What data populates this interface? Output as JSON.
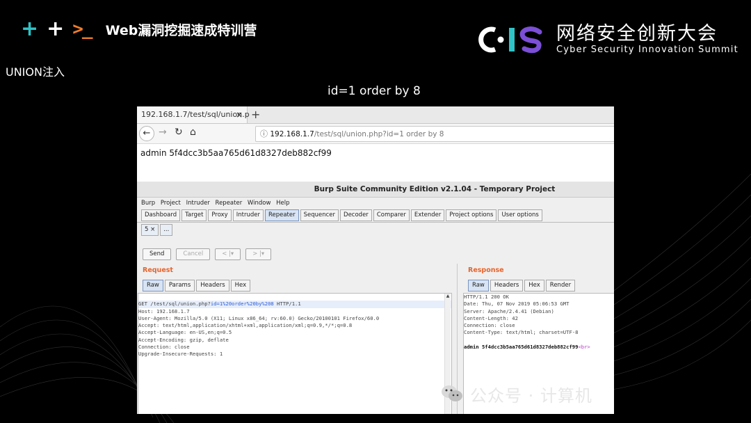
{
  "header": {
    "icons": [
      "plus-teal-icon",
      "plus-white-icon",
      "terminal-prompt-icon"
    ],
    "prompt_glyph": ">_",
    "course_title": "Web漏洞挖掘速成特训营"
  },
  "logo": {
    "cn": "网络安全创新大会",
    "en": "Cyber Security Innovation Summit",
    "colors": {
      "c": "#ffffff",
      "i": "#2fc3c7",
      "s": "#7b4fd6"
    }
  },
  "slide": {
    "subtitle": "UNION注入",
    "caption": "id=1 order by 8"
  },
  "browser": {
    "tab_title": "192.168.1.7/test/sql/union.p",
    "tab_close": "×",
    "new_tab": "+",
    "url_host": "192.168.1.7",
    "url_path": "/test/sql/union.php?id=1 order by 8",
    "page_text": "admin 5f4dcc3b5aa765d61d8327deb882cf99"
  },
  "burp": {
    "title": "Burp Suite Community Edition v2.1.04 - Temporary Project",
    "menu": [
      "Burp",
      "Project",
      "Intruder",
      "Repeater",
      "Window",
      "Help"
    ],
    "tabs": [
      "Dashboard",
      "Target",
      "Proxy",
      "Intruder",
      "Repeater",
      "Sequencer",
      "Decoder",
      "Comparer",
      "Extender",
      "Project options",
      "User options"
    ],
    "active_tab": "Repeater",
    "sub_tabs": [
      "5 ×",
      "..."
    ],
    "buttons": {
      "send": "Send",
      "cancel": "Cancel",
      "back": "< |▾",
      "fwd": "> |▾"
    },
    "request": {
      "heading": "Request",
      "tabs": [
        "Raw",
        "Params",
        "Headers",
        "Hex"
      ],
      "line1_a": "GET /test/sql/union.php?",
      "line1_param": "id=1%20order%20by%208",
      "line1_b": " HTTP/1.1",
      "lines": [
        "Host: 192.168.1.7",
        "User-Agent: Mozilla/5.0 (X11; Linux x86_64; rv:60.0) Gecko/20100101 Firefox/60.0",
        "Accept: text/html,application/xhtml+xml,application/xml;q=0.9,*/*;q=0.8",
        "Accept-Language: en-US,en;q=0.5",
        "Accept-Encoding: gzip, deflate",
        "Connection: close",
        "Upgrade-Insecure-Requests: 1"
      ]
    },
    "response": {
      "heading": "Response",
      "tabs": [
        "Raw",
        "Headers",
        "Hex",
        "Render"
      ],
      "lines": [
        "HTTP/1.1 200 OK",
        "Date: Thu, 07 Nov 2019 05:06:53 GMT",
        "Server: Apache/2.4.41 (Debian)",
        "Content-Length: 42",
        "Connection: close",
        "Content-Type: text/html; charset=UTF-8"
      ],
      "body": "admin 5f4dcc3b5aa765d61d8327deb882cf99",
      "body_tag": "<br>"
    }
  },
  "watermark": {
    "icon": "wechat-icon",
    "text": "公众号 · 计算机"
  }
}
